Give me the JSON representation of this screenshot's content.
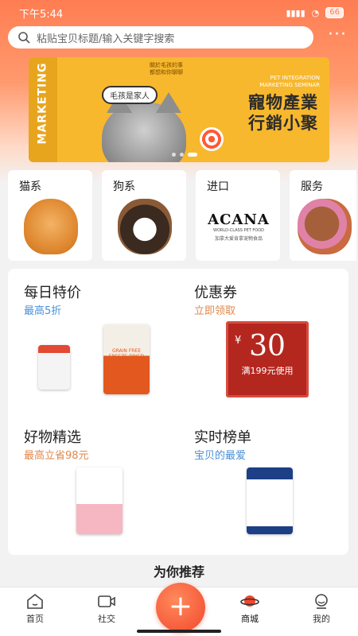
{
  "status": {
    "time": "下午5:44",
    "signal": "4G",
    "battery": "66"
  },
  "search": {
    "placeholder": "粘贴宝贝标题/输入关键字搜索",
    "more": "···"
  },
  "banner": {
    "side_text": "MARKETING",
    "note": "關於毛孩的事\n都想和你聊聊",
    "bubble": "毛孩是家人",
    "english": "PET INTEGRATION\nMARKETING SEMINAR",
    "title_line1": "寵物產業",
    "title_line2": "行銷小聚"
  },
  "categories": [
    {
      "label": "猫系"
    },
    {
      "label": "狗系"
    },
    {
      "label": "进口",
      "brand": "ACANA",
      "brand_sub": "WORLD-CLASS PET FOOD",
      "brand_cn": "加拿大爱肯拿宠物食品"
    },
    {
      "label": "服务"
    }
  ],
  "promos": [
    {
      "title": "每日特价",
      "subtitle": "最高5折",
      "subtitle_color": "blue",
      "bag_text": "GRAIN FREE\nFREEZE-DRIED"
    },
    {
      "title": "优惠券",
      "subtitle": "立即领取",
      "subtitle_color": "orange",
      "coupon": {
        "currency": "¥",
        "amount": "30",
        "condition": "满199元使用"
      }
    },
    {
      "title": "好物精选",
      "subtitle": "最高立省98元",
      "subtitle_color": "orange"
    },
    {
      "title": "实时榜单",
      "subtitle": "宝贝的最爱",
      "subtitle_color": "blue"
    }
  ],
  "recommend": {
    "title": "为你推荐"
  },
  "tabbar": {
    "items": [
      {
        "label": "首页",
        "icon": "home-icon"
      },
      {
        "label": "社交",
        "icon": "video-icon"
      },
      {
        "label": "+",
        "icon": "plus-icon"
      },
      {
        "label": "商城",
        "icon": "planet-icon"
      },
      {
        "label": "我的",
        "icon": "profile-icon"
      }
    ]
  },
  "colors": {
    "accent": "#ff7d52",
    "blue": "#4a8fd8",
    "orange": "#e0884c",
    "coupon": "#b4271f"
  }
}
